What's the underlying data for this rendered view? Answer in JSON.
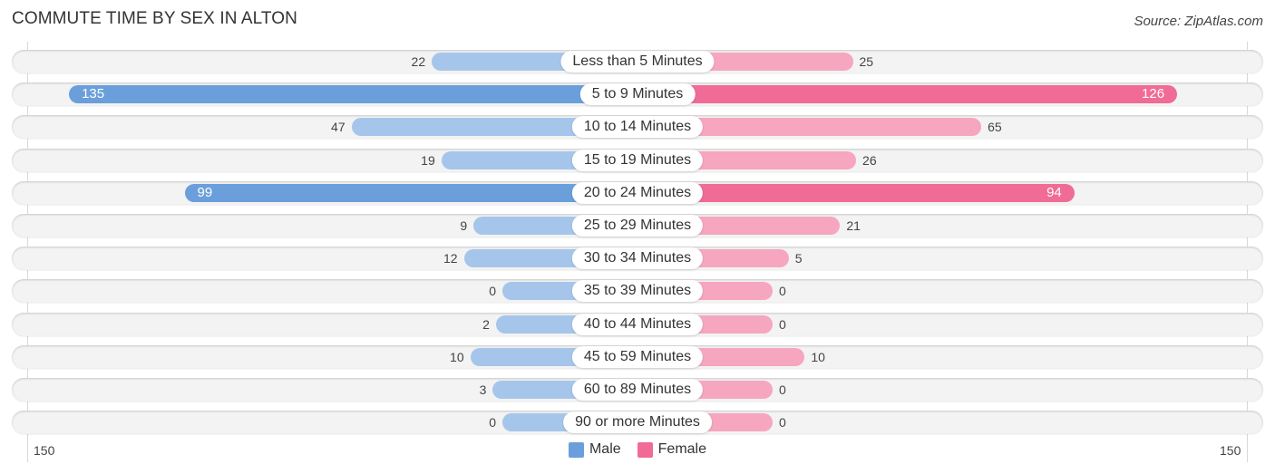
{
  "header": {
    "title": "COMMUTE TIME BY SEX IN ALTON",
    "source": "Source: ZipAtlas.com"
  },
  "colors": {
    "male": "#a5c6ea",
    "male_strong": "#6a9fdb",
    "female": "#f6a6bf",
    "female_strong": "#f06b95"
  },
  "legend": {
    "male_label": "Male",
    "female_label": "Female",
    "male_color": "#6a9fdb",
    "female_color": "#f06b95"
  },
  "axis": {
    "left_tick": "150",
    "right_tick": "150"
  },
  "chart_data": {
    "type": "bar",
    "orientation": "horizontal-diverging",
    "title": "COMMUTE TIME BY SEX IN ALTON",
    "xlabel": "",
    "ylabel": "",
    "xlim": [
      -150,
      150
    ],
    "legend_position": "bottom-center",
    "grid": false,
    "categories": [
      "Less than 5 Minutes",
      "5 to 9 Minutes",
      "10 to 14 Minutes",
      "15 to 19 Minutes",
      "20 to 24 Minutes",
      "25 to 29 Minutes",
      "30 to 34 Minutes",
      "35 to 39 Minutes",
      "40 to 44 Minutes",
      "45 to 59 Minutes",
      "60 to 89 Minutes",
      "90 or more Minutes"
    ],
    "series": [
      {
        "name": "Male",
        "side": "left",
        "values": [
          22,
          135,
          47,
          19,
          99,
          9,
          12,
          0,
          2,
          10,
          3,
          0
        ]
      },
      {
        "name": "Female",
        "side": "right",
        "values": [
          25,
          126,
          65,
          26,
          94,
          21,
          5,
          0,
          0,
          10,
          0,
          0
        ]
      }
    ]
  }
}
